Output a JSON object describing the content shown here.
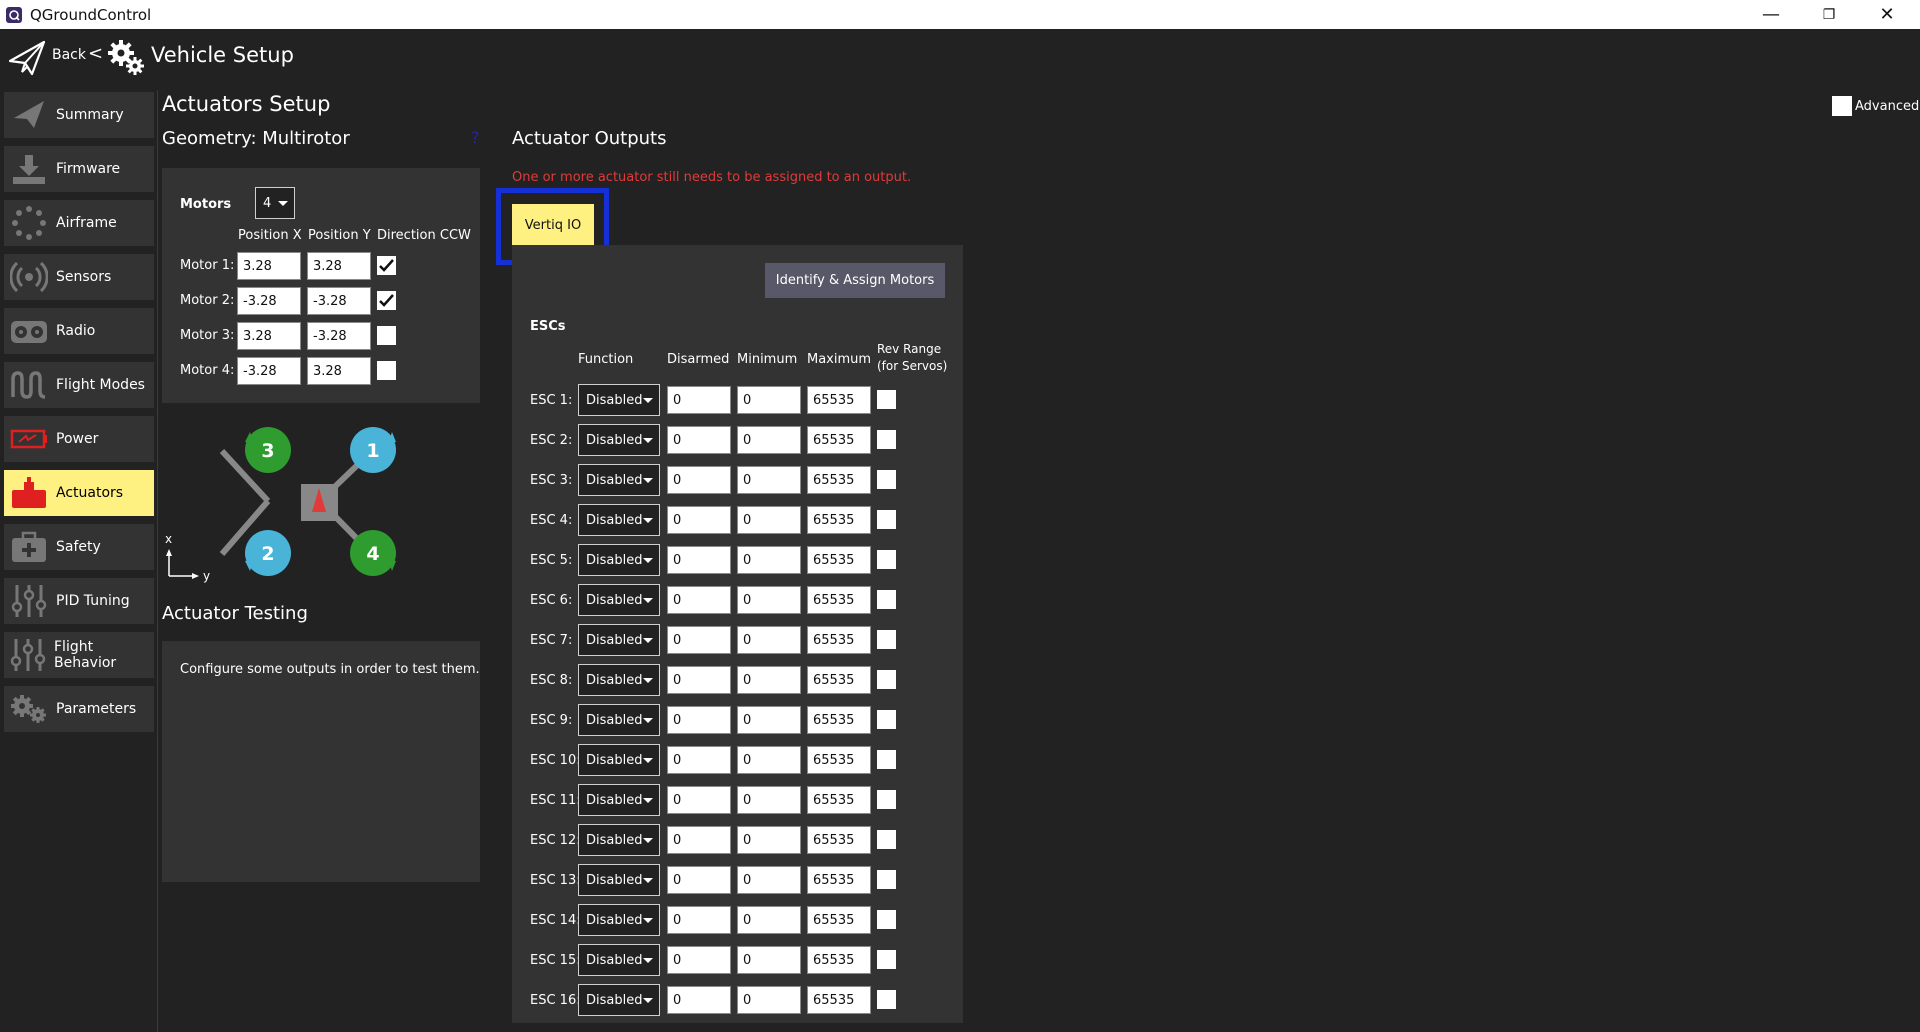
{
  "window": {
    "title": "QGroundControl",
    "minimize": "—",
    "restore": "❐",
    "close": "✕"
  },
  "header": {
    "back_label": "Back",
    "separator": "<",
    "title": "Vehicle Setup"
  },
  "sidebar": {
    "items": [
      {
        "label": "Summary",
        "icon": "paper-plane-icon"
      },
      {
        "label": "Firmware",
        "icon": "download-icon"
      },
      {
        "label": "Airframe",
        "icon": "airframe-icon"
      },
      {
        "label": "Sensors",
        "icon": "sensors-icon"
      },
      {
        "label": "Radio",
        "icon": "radio-icon"
      },
      {
        "label": "Flight Modes",
        "icon": "wave-icon"
      },
      {
        "label": "Power",
        "icon": "battery-icon"
      },
      {
        "label": "Actuators",
        "icon": "actuator-icon",
        "active": true
      },
      {
        "label": "Safety",
        "icon": "medkit-icon"
      },
      {
        "label": "PID Tuning",
        "icon": "sliders-icon"
      },
      {
        "label": "Flight Behavior",
        "icon": "sliders-icon"
      },
      {
        "label": "Parameters",
        "icon": "gears-icon"
      }
    ]
  },
  "actuators": {
    "title": "Actuators Setup",
    "advanced_label": "Advanced",
    "advanced_checked": false,
    "geometry": {
      "title": "Geometry: Multirotor",
      "help": "?",
      "motors_label": "Motors",
      "motors_count": "4",
      "col_x": "Position X",
      "col_y": "Position Y",
      "col_dir": "Direction CCW",
      "motors": [
        {
          "label": "Motor 1:",
          "x": "3.28",
          "y": "3.28",
          "ccw": true
        },
        {
          "label": "Motor 2:",
          "x": "-3.28",
          "y": "-3.28",
          "ccw": true
        },
        {
          "label": "Motor 3:",
          "x": "3.28",
          "y": "-3.28",
          "ccw": false
        },
        {
          "label": "Motor 4:",
          "x": "-3.28",
          "y": "3.28",
          "ccw": false
        }
      ]
    },
    "diagram": {
      "motor_labels": [
        "1",
        "2",
        "3",
        "4"
      ],
      "axis_x": "x",
      "axis_y": "y",
      "colors": {
        "cw": "#4ab3d8",
        "ccw": "#2e9c2e",
        "frame": "#888888",
        "arrow": "#e03a3a"
      }
    },
    "testing": {
      "title": "Actuator Testing",
      "message": "Configure some outputs in order to test them."
    },
    "outputs": {
      "title": "Actuator Outputs",
      "warning": "One or more actuator still needs to be assigned to an output.",
      "tab_label": "Vertiq IO",
      "identify_button": "Identify & Assign Motors",
      "escs_label": "ESCs",
      "headers": {
        "function": "Function",
        "disarmed": "Disarmed",
        "minimum": "Minimum",
        "maximum": "Maximum",
        "rev_line1": "Rev Range",
        "rev_line2": "(for Servos)"
      },
      "escs": [
        {
          "label": "ESC 1:",
          "function": "Disabled",
          "disarmed": "0",
          "minimum": "0",
          "maximum": "65535",
          "rev": false
        },
        {
          "label": "ESC 2:",
          "function": "Disabled",
          "disarmed": "0",
          "minimum": "0",
          "maximum": "65535",
          "rev": false
        },
        {
          "label": "ESC 3:",
          "function": "Disabled",
          "disarmed": "0",
          "minimum": "0",
          "maximum": "65535",
          "rev": false
        },
        {
          "label": "ESC 4:",
          "function": "Disabled",
          "disarmed": "0",
          "minimum": "0",
          "maximum": "65535",
          "rev": false
        },
        {
          "label": "ESC 5:",
          "function": "Disabled",
          "disarmed": "0",
          "minimum": "0",
          "maximum": "65535",
          "rev": false
        },
        {
          "label": "ESC 6:",
          "function": "Disabled",
          "disarmed": "0",
          "minimum": "0",
          "maximum": "65535",
          "rev": false
        },
        {
          "label": "ESC 7:",
          "function": "Disabled",
          "disarmed": "0",
          "minimum": "0",
          "maximum": "65535",
          "rev": false
        },
        {
          "label": "ESC 8:",
          "function": "Disabled",
          "disarmed": "0",
          "minimum": "0",
          "maximum": "65535",
          "rev": false
        },
        {
          "label": "ESC 9:",
          "function": "Disabled",
          "disarmed": "0",
          "minimum": "0",
          "maximum": "65535",
          "rev": false
        },
        {
          "label": "ESC 10:",
          "function": "Disabled",
          "disarmed": "0",
          "minimum": "0",
          "maximum": "65535",
          "rev": false
        },
        {
          "label": "ESC 11:",
          "function": "Disabled",
          "disarmed": "0",
          "minimum": "0",
          "maximum": "65535",
          "rev": false
        },
        {
          "label": "ESC 12:",
          "function": "Disabled",
          "disarmed": "0",
          "minimum": "0",
          "maximum": "65535",
          "rev": false
        },
        {
          "label": "ESC 13:",
          "function": "Disabled",
          "disarmed": "0",
          "minimum": "0",
          "maximum": "65535",
          "rev": false
        },
        {
          "label": "ESC 14:",
          "function": "Disabled",
          "disarmed": "0",
          "minimum": "0",
          "maximum": "65535",
          "rev": false
        },
        {
          "label": "ESC 15:",
          "function": "Disabled",
          "disarmed": "0",
          "minimum": "0",
          "maximum": "65535",
          "rev": false
        },
        {
          "label": "ESC 16:",
          "function": "Disabled",
          "disarmed": "0",
          "minimum": "0",
          "maximum": "65535",
          "rev": false
        }
      ]
    }
  },
  "theme": {
    "background": "#222222",
    "panel": "#333333",
    "accent": "#fff082",
    "highlight_border": "#1630d8",
    "warning": "#e03a3a"
  }
}
